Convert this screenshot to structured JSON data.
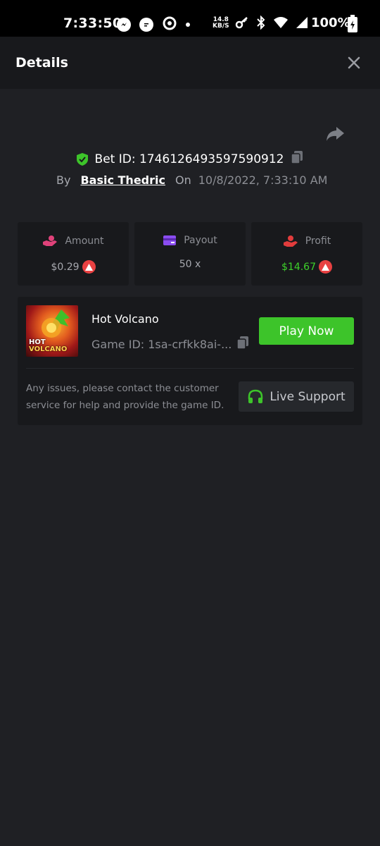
{
  "status_bar": {
    "time": "7:33:50",
    "net_speed_value": "14.8",
    "net_speed_unit": "KB/S",
    "battery": "100%",
    "icons": [
      "messenger-icon",
      "chat-bubble-icon",
      "circle-app-icon",
      "dot-icon",
      "key-icon",
      "bluetooth-icon",
      "wifi-icon",
      "signal-icon",
      "battery-charging-icon"
    ]
  },
  "header": {
    "title": "Details",
    "close_icon": "close-icon"
  },
  "bet": {
    "id_text": "Bet ID: 1746126493597590912",
    "by_label": "By",
    "user": "Basic Thedric",
    "on_label": "On",
    "datetime": "10/8/2022, 7:33:10 AM"
  },
  "stats": {
    "amount": {
      "label": "Amount",
      "value": "$0.29",
      "icon": "money-hand-icon"
    },
    "payout": {
      "label": "Payout",
      "value": "50 x",
      "icon": "card-icon"
    },
    "profit": {
      "label": "Profit",
      "value": "$14.67",
      "icon": "profit-hand-icon"
    }
  },
  "game": {
    "name": "Hot Volcano",
    "game_id": "Game ID: 1sa-crfkk8ai-...",
    "play_label": "Play Now",
    "thumb_title_1": "HOT",
    "thumb_title_2": "VOLCANO"
  },
  "help": {
    "text": "Any issues, please contact the customer service for help and provide the game ID.",
    "support_label": "Live Support"
  },
  "colors": {
    "background": "#1f2024",
    "panel": "#18191c",
    "accent_green": "#3dc42a",
    "avax_red": "#e84142"
  }
}
